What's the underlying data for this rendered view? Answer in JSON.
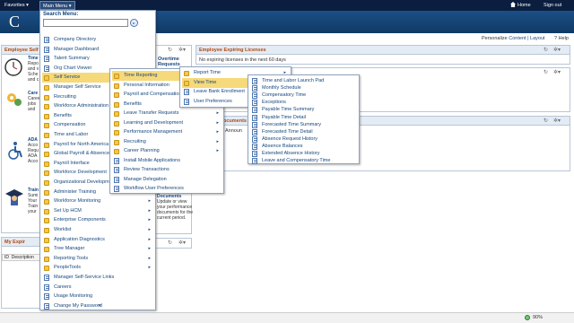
{
  "topbar": {
    "favorites": "Favorites ▾",
    "main_menu": "Main Menu ▾",
    "home": "Home",
    "signout": "Sign out"
  },
  "banner": {
    "logo": "C"
  },
  "personalize": {
    "prefix": "Personalize",
    "content": "Content",
    "sep": "|",
    "layout": "Layout",
    "help": "Help"
  },
  "pagelets": {
    "employee_self": "Employee Self",
    "employee_licenses": {
      "title": "Employee Expiring Licenses",
      "body": "No expiring licenses in the next 60 days"
    },
    "overtime": {
      "col1": "Overtime",
      "col2": "Requests"
    },
    "documents": {
      "title": "Documents",
      "body": "Update or view your performance documents for the current period."
    },
    "my_expir": "My Expir",
    "docs_announ": "ocuments",
    "announ": "Announ",
    "my_expir_cols": [
      "ID",
      "Description"
    ]
  },
  "left_items": [
    {
      "title": "Time",
      "text": "Repo and v Sche and c requ"
    },
    {
      "title": "Care",
      "text": "Careers jobs and appl"
    },
    {
      "title": "ADA",
      "text": "Acco Requ ADA Acco Requ"
    },
    {
      "title": "Train",
      "text": "Sumi Your Train your infor"
    }
  ],
  "main_menu": {
    "search_title": "Search Menu:",
    "search_placeholder": "",
    "items": [
      {
        "label": "Company Directory",
        "type": "doc",
        "arrow": ""
      },
      {
        "label": "Manager Dashboard",
        "type": "doc",
        "arrow": ""
      },
      {
        "label": "Talent Summary",
        "type": "doc",
        "arrow": ""
      },
      {
        "label": "Org Chart Viewer",
        "type": "doc",
        "arrow": ""
      },
      {
        "label": "Self Service",
        "type": "fold",
        "arrow": "▸"
      },
      {
        "label": "Manager Self Service",
        "type": "fold",
        "arrow": "▸"
      },
      {
        "label": "Recruiting",
        "type": "fold",
        "arrow": "▸"
      },
      {
        "label": "Workforce Administration",
        "type": "fold",
        "arrow": "▸"
      },
      {
        "label": "Benefits",
        "type": "fold",
        "arrow": "▸"
      },
      {
        "label": "Compensation",
        "type": "fold",
        "arrow": "▸"
      },
      {
        "label": "Time and Labor",
        "type": "fold",
        "arrow": "▸"
      },
      {
        "label": "Payroll for North America",
        "type": "fold",
        "arrow": "▸"
      },
      {
        "label": "Global Payroll & Absence Mgmt",
        "type": "fold",
        "arrow": "▸"
      },
      {
        "label": "Payroll Interface",
        "type": "fold",
        "arrow": "▸"
      },
      {
        "label": "Workforce Development",
        "type": "fold",
        "arrow": "▸"
      },
      {
        "label": "Organizational Development",
        "type": "fold",
        "arrow": "▸"
      },
      {
        "label": "Administer Training",
        "type": "fold",
        "arrow": "▸"
      },
      {
        "label": "Workforce Monitoring",
        "type": "fold",
        "arrow": "▸"
      },
      {
        "label": "Set Up HCM",
        "type": "fold",
        "arrow": "▸"
      },
      {
        "label": "Enterprise Components",
        "type": "fold",
        "arrow": "▸"
      },
      {
        "label": "Worklist",
        "type": "fold",
        "arrow": "▸"
      },
      {
        "label": "Application Diagnostics",
        "type": "fold",
        "arrow": "▸"
      },
      {
        "label": "Tree Manager",
        "type": "fold",
        "arrow": "▸"
      },
      {
        "label": "Reporting Tools",
        "type": "fold",
        "arrow": "▸"
      },
      {
        "label": "PeopleTools",
        "type": "fold",
        "arrow": "▸"
      },
      {
        "label": "Manager Self-Service Links",
        "type": "doc",
        "arrow": ""
      },
      {
        "label": "Careers",
        "type": "doc",
        "arrow": ""
      },
      {
        "label": "Usage Monitoring",
        "type": "doc",
        "arrow": ""
      },
      {
        "label": "Change My Password",
        "type": "doc",
        "arrow": ""
      }
    ],
    "scroll_down": "▾"
  },
  "self_service_menu": {
    "items": [
      {
        "label": "Time Reporting",
        "type": "fold",
        "arrow": "▸"
      },
      {
        "label": "Personal Information",
        "type": "fold",
        "arrow": "▸"
      },
      {
        "label": "Payroll and Compensation",
        "type": "fold",
        "arrow": "▸"
      },
      {
        "label": "Benefits",
        "type": "fold",
        "arrow": "▸"
      },
      {
        "label": "Leave Transfer Requests",
        "type": "fold",
        "arrow": "▸"
      },
      {
        "label": "Learning and Development",
        "type": "fold",
        "arrow": "▸"
      },
      {
        "label": "Performance Management",
        "type": "fold",
        "arrow": "▸"
      },
      {
        "label": "Recruiting",
        "type": "fold",
        "arrow": "▸"
      },
      {
        "label": "Career Planning",
        "type": "fold",
        "arrow": "▸"
      },
      {
        "label": "Install Mobile Applications",
        "type": "doc",
        "arrow": ""
      },
      {
        "label": "Review Transactions",
        "type": "doc",
        "arrow": ""
      },
      {
        "label": "Manage Delegation",
        "type": "doc",
        "arrow": ""
      },
      {
        "label": "Workflow User Preferences",
        "type": "doc",
        "arrow": ""
      }
    ]
  },
  "time_reporting_menu": {
    "items": [
      {
        "label": "Report Time",
        "type": "fold",
        "arrow": "▸"
      },
      {
        "label": "View Time",
        "type": "fold",
        "arrow": "▸"
      },
      {
        "label": "Leave Bank Enrollment",
        "type": "doc",
        "arrow": ""
      },
      {
        "label": "User Preferences",
        "type": "doc",
        "arrow": ""
      }
    ]
  },
  "view_time_menu": {
    "items": [
      {
        "label": "Time and Labor Launch Pad"
      },
      {
        "label": "Monthly Schedule"
      },
      {
        "label": "Compensatory Time"
      },
      {
        "label": "Exceptions"
      },
      {
        "label": "Payable Time Summary"
      },
      {
        "label": "Payable Time Detail"
      },
      {
        "label": "Forecasted Time Summary"
      },
      {
        "label": "Forecasted Time Detail"
      },
      {
        "label": "Absence Request History"
      },
      {
        "label": "Absence Balances"
      },
      {
        "label": "Extended Absence History"
      },
      {
        "label": "Leave and Compensatory Time"
      }
    ]
  },
  "statusbar": {
    "zoom": "90%"
  },
  "colors": {
    "topbar": "#0b1e3f",
    "banner": "#1c4f86",
    "highlight": "#f6d97a",
    "link": "#15467d",
    "pagelet_title": "#b0480d"
  }
}
